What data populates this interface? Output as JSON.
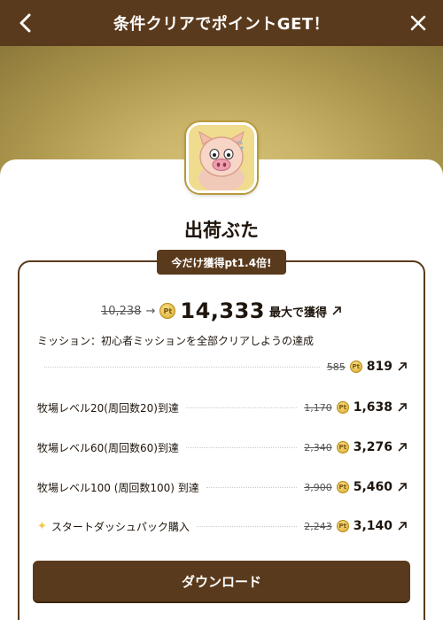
{
  "header": {
    "title": "条件クリアでポイントGET！"
  },
  "app": {
    "name": "出荷ぶた"
  },
  "bonus": {
    "badge": "今だけ獲得pt1.4倍!"
  },
  "total": {
    "old": "10,238",
    "arrow": "→",
    "new": "14,333",
    "suffix": "最大で獲得"
  },
  "mission": {
    "text": "ミッション：初心者ミッションを全部クリアしようの達成",
    "old": "585",
    "new": "819"
  },
  "rewards": [
    {
      "label": "牧場レベル20(周回数20)到達",
      "old": "1,170",
      "new": "1,638"
    },
    {
      "label": "牧場レベル60(周回数60)到達",
      "old": "2,340",
      "new": "3,276"
    },
    {
      "label": "牧場レベル100 (周回数100) 到達",
      "old": "3,900",
      "new": "5,460"
    },
    {
      "label": "スタートダッシュパック購入",
      "old": "2,243",
      "new": "3,140"
    }
  ],
  "pt_glyph": "Pt",
  "download": {
    "label": "ダウンロード"
  },
  "colors": {
    "brand_brown": "#5a3a1c",
    "gold": "#d9a92a"
  }
}
